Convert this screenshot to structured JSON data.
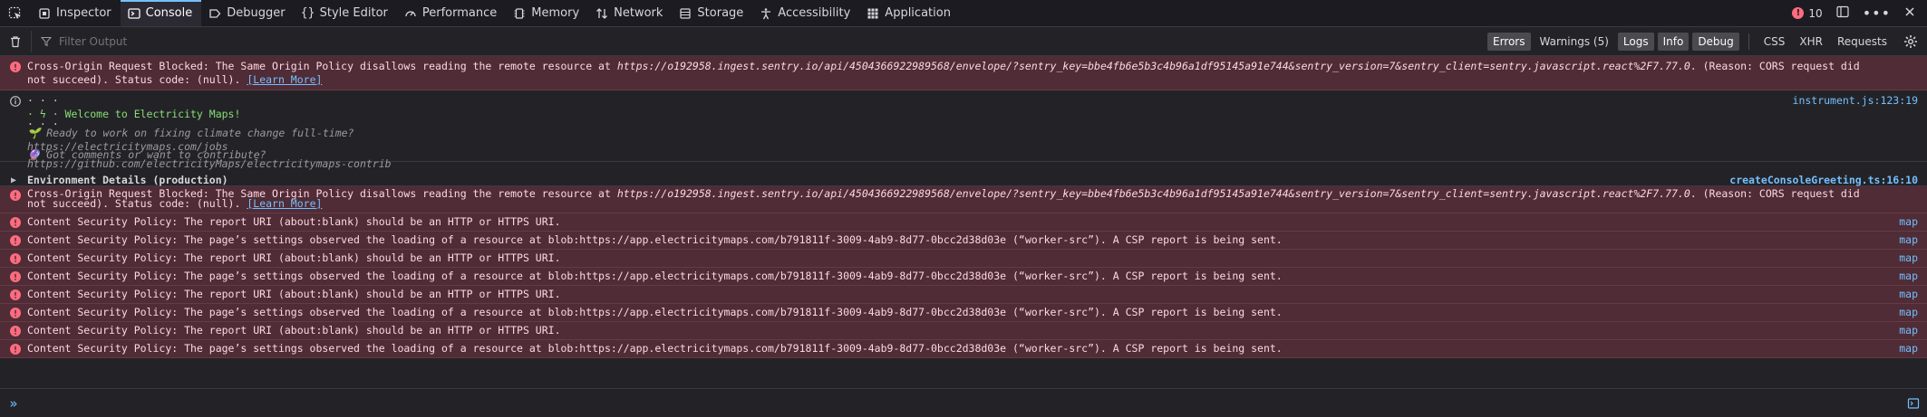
{
  "toolbar": {
    "tabs": [
      {
        "label": "Inspector",
        "icon": "inspector-icon"
      },
      {
        "label": "Console",
        "icon": "console-icon"
      },
      {
        "label": "Debugger",
        "icon": "debugger-icon"
      },
      {
        "label": "Style Editor",
        "icon": "style-editor-icon"
      },
      {
        "label": "Performance",
        "icon": "performance-icon"
      },
      {
        "label": "Memory",
        "icon": "memory-icon"
      },
      {
        "label": "Network",
        "icon": "network-icon"
      },
      {
        "label": "Storage",
        "icon": "storage-icon"
      },
      {
        "label": "Accessibility",
        "icon": "accessibility-icon"
      },
      {
        "label": "Application",
        "icon": "application-icon"
      }
    ],
    "active_tab": "Console",
    "error_count": "10"
  },
  "filter": {
    "placeholder": "Filter Output",
    "buttons": [
      {
        "label": "Errors",
        "on": true
      },
      {
        "label": "Warnings (5)",
        "on": false
      },
      {
        "label": "Logs",
        "on": true
      },
      {
        "label": "Info",
        "on": true
      },
      {
        "label": "Debug",
        "on": true
      }
    ],
    "request_buttons": [
      "CSS",
      "XHR",
      "Requests"
    ]
  },
  "messages": {
    "cors1": {
      "prefix": "Cross-Origin Request Blocked: The Same Origin Policy disallows reading the remote resource at ",
      "url": "https://o192958.ingest.sentry.io/api/4504366922989568/envelope/?sentry_key=bbe4fb6e5b3c4b96a1df95145a91e744&sentry_version=7&sentry_client=sentry.javascript.react%2F7.77.0",
      "suffix": ". (Reason: CORS request did not succeed). Status code: (null).",
      "learn": "[Learn More]"
    },
    "greeting": {
      "lines": [
        "· · ·",
        "· ϟ · Welcome to Electricity Maps!",
        "· · ·"
      ],
      "jobs_text": "🌱 Ready to work on fixing climate change full-time?",
      "jobs_url": "https://electricitymaps.com/jobs",
      "contrib_text": "🔮 Got comments or want to contribute?",
      "contrib_url": "https://github.com/electricityMaps/electricitymaps-contrib",
      "location": "instrument.js:123:19"
    },
    "env": {
      "label": "Environment Details (production)",
      "location": "createConsoleGreeting.ts:16:10"
    },
    "cors2": {
      "prefix": "Cross-Origin Request Blocked: The Same Origin Policy disallows reading the remote resource at ",
      "url": "https://o192958.ingest.sentry.io/api/4504366922989568/envelope/?sentry_key=bbe4fb6e5b3c4b96a1df95145a91e744&sentry_version=7&sentry_client=sentry.javascript.react%2F7.77.0",
      "suffix": ". (Reason: CORS request did not succeed). Status code: (null).",
      "learn": "[Learn More]"
    },
    "csp_report": "Content Security Policy: The report URI (about:blank) should be an HTTP or HTTPS URI.",
    "csp_blob": "Content Security Policy: The page’s settings observed the loading of a resource at blob:https://app.electricitymaps.com/b791811f-3009-4ab9-8d77-0bcc2d38d03e (“worker-src”). A CSP report is being sent.",
    "csp_location": "map"
  },
  "colors": {
    "accent": "#75bfff",
    "error_bg": "#4f2c36",
    "error_icon": "#ff6b7f",
    "welcome_green": "#86de74"
  }
}
